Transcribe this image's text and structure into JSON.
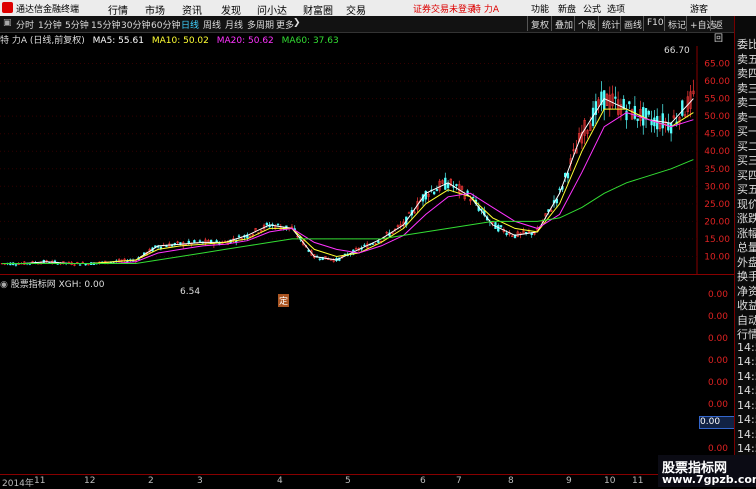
{
  "menubar": {
    "app_title": "通达信金融终端",
    "menus": [
      "行情",
      "市场",
      "资讯",
      "发现",
      "问小达",
      "财富圈",
      "交易"
    ],
    "notice": "证券交易未登录",
    "stock_tag": "特 力A",
    "right": [
      "功能",
      "新盘",
      "公式",
      "选项",
      "游客"
    ]
  },
  "toolbar": {
    "periods": [
      "分时",
      "1分钟",
      "5分钟",
      "15分钟",
      "30分钟",
      "60分钟",
      "日线",
      "周线",
      "月线",
      "多周期",
      "更多"
    ],
    "active_period": "日线",
    "more_arrow": "❯",
    "buttons": [
      "复权",
      "叠加",
      "个股",
      "统计",
      "画线",
      "F10",
      "标记",
      "+自选",
      "返回"
    ]
  },
  "legend": {
    "stock": "特 力A (日线,前复权)",
    "ma5": "MA5: 55.61",
    "ma10": "MA10: 50.02",
    "ma20": "MA20: 50.62",
    "ma60": "MA60: 37.63"
  },
  "annotations": {
    "high": "66.70",
    "low": "6.54",
    "marker": "定"
  },
  "price_axis": [
    "65.00",
    "60.00",
    "55.00",
    "50.00",
    "45.00",
    "40.00",
    "35.00",
    "30.00",
    "25.00",
    "20.00",
    "15.00",
    "10.00"
  ],
  "indicator": {
    "legend": "股票指标网 XGH: 0.00",
    "axis": [
      "0.00",
      "0.00",
      "0.00",
      "0.00",
      "0.00",
      "0.00",
      "0.00",
      "0.00"
    ],
    "current_box": "0.00"
  },
  "time_axis": [
    "2014年",
    "11",
    "12",
    "2",
    "3",
    "4",
    "5",
    "6",
    "7",
    "8",
    "9",
    "10",
    "11"
  ],
  "right_panel": [
    "委比",
    "卖五",
    "卖四",
    "卖三",
    "卖二",
    "卖一",
    "买一",
    "买二",
    "买三",
    "买四",
    "买五",
    "现价",
    "涨跌",
    "涨幅",
    "总量",
    "外盘",
    "换手",
    "净资",
    "收益",
    "自动",
    "行情",
    "14:5",
    "14:5",
    "14:5",
    "14:5",
    "14:5",
    "14:5",
    "14:5",
    "14:5",
    "14:5",
    "14:5"
  ],
  "watermark": {
    "line1": "股票指标网",
    "line2": "www.7gpzb.com"
  },
  "colors": {
    "up": "#ff3a3a",
    "down": "#5ff",
    "ma5": "#ffffff",
    "ma10": "#ffff33",
    "ma20": "#ff33ff",
    "ma60": "#33dd33",
    "axis": "#d22"
  },
  "chart_data": {
    "type": "line",
    "title": "特 力A (日线,前复权)",
    "ylim": [
      5,
      70
    ],
    "series": [
      {
        "name": "MA5",
        "values": [
          8,
          8,
          8.5,
          8,
          8,
          8.5,
          9,
          13,
          13.5,
          14,
          14,
          16,
          19,
          18,
          10,
          9,
          12,
          15,
          19,
          28,
          31,
          27,
          19,
          16,
          17,
          28,
          45,
          55,
          52,
          49,
          48,
          55
        ]
      },
      {
        "name": "MA10",
        "values": [
          8,
          8,
          8,
          8,
          8,
          8.5,
          9,
          12,
          13,
          13.5,
          14,
          15,
          18,
          18,
          12,
          10,
          11,
          14,
          18,
          25,
          29,
          27,
          21,
          18,
          17,
          25,
          40,
          52,
          52,
          49,
          47,
          51
        ]
      },
      {
        "name": "MA20",
        "values": [
          8,
          8,
          8,
          8,
          8,
          8,
          8.5,
          11,
          12,
          13,
          13.5,
          14.5,
          17,
          18,
          14,
          12,
          11,
          13,
          16,
          22,
          27,
          28,
          24,
          20,
          18,
          22,
          34,
          47,
          51,
          49,
          47,
          49
        ]
      },
      {
        "name": "MA60",
        "values": [
          8,
          8,
          8,
          8,
          8,
          8,
          8,
          9,
          10,
          11,
          12,
          13,
          14,
          15,
          15,
          15,
          15,
          15,
          16,
          17,
          18,
          19,
          20,
          20,
          20,
          21,
          24,
          28,
          31,
          33,
          35,
          37.6
        ]
      }
    ]
  }
}
